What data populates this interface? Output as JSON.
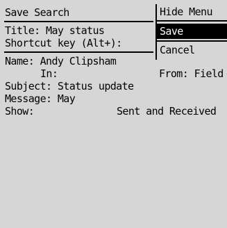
{
  "header": {
    "title": "Save Search"
  },
  "form": {
    "title_line": "Title: May status",
    "shortcut_line": "Shortcut key (Alt+):"
  },
  "criteria": {
    "name_line": "Name: Andy Clipsham",
    "in_label": "In:",
    "from_label": "From: Field",
    "subject_line": "Subject: Status update",
    "message_line": "Message: May",
    "show_label": "Show:",
    "show_value": "Sent and Received"
  },
  "menu": {
    "items": [
      {
        "label": "Hide Menu"
      },
      {
        "label": "Save"
      },
      {
        "label": "Cancel"
      }
    ]
  }
}
